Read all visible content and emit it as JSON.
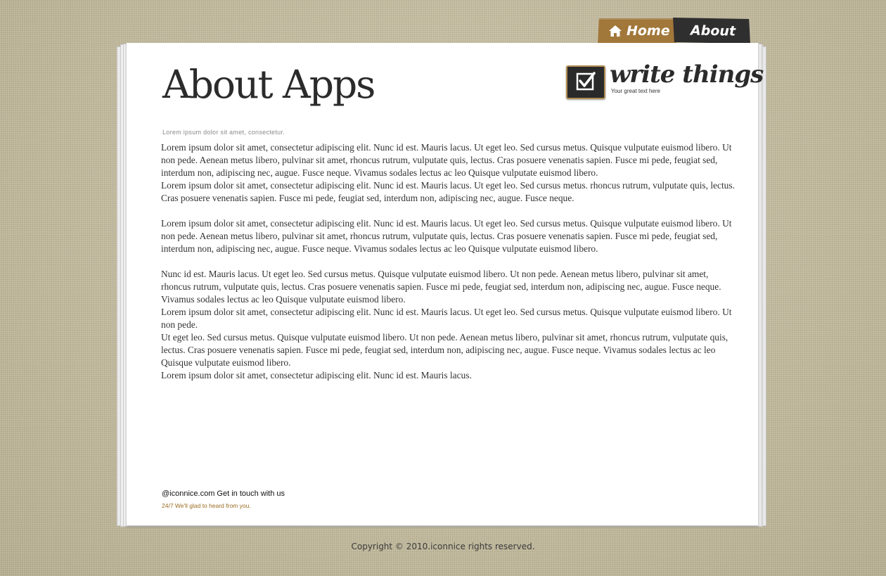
{
  "nav": {
    "home_label": "Home",
    "about_label": "About",
    "home_color": "#a2773a",
    "about_color": "#2f2f2f"
  },
  "header": {
    "title": "About Apps",
    "logo_text": "write things",
    "logo_tagline": "Your great text here",
    "logo_icon": "checkbox-icon"
  },
  "main": {
    "subheading": "Lorem ipsum dolor sit amet, consectetur.",
    "paragraph_1": "Lorem ipsum dolor sit amet, consectetur adipiscing elit. Nunc id est. Mauris lacus. Ut eget leo. Sed cursus metus. Quisque vulputate euismod libero. Ut non pede. Aenean metus libero, pulvinar sit amet, rhoncus rutrum, vulputate quis, lectus. Cras posuere venenatis sapien. Fusce mi pede, feugiat sed, interdum non, adipiscing nec, augue. Fusce neque. Vivamus sodales lectus ac leo Quisque vulputate euismod libero.",
    "paragraph_2": "Lorem ipsum dolor sit amet, consectetur adipiscing elit. Nunc id est. Mauris lacus. Ut eget leo. Sed cursus metus. rhoncus rutrum, vulputate quis, lectus. Cras posuere venenatis sapien. Fusce mi pede, feugiat sed, interdum non, adipiscing nec, augue. Fusce neque.",
    "paragraph_3": "Lorem ipsum dolor sit amet, consectetur adipiscing elit. Nunc id est. Mauris lacus. Ut eget leo. Sed cursus metus. Quisque vulputate euismod libero. Ut non pede. Aenean metus libero, pulvinar sit amet, rhoncus rutrum, vulputate quis, lectus. Cras posuere venenatis sapien. Fusce mi pede, feugiat sed, interdum non, adipiscing nec, augue. Fusce neque. Vivamus sodales lectus ac leo Quisque vulputate euismod libero.",
    "paragraph_4": "Nunc id est. Mauris lacus. Ut eget leo. Sed cursus metus. Quisque vulputate euismod libero. Ut non pede. Aenean metus libero, pulvinar sit amet, rhoncus rutrum, vulputate quis, lectus. Cras posuere venenatis sapien. Fusce mi pede, feugiat sed, interdum non, adipiscing nec, augue. Fusce neque. Vivamus sodales lectus ac leo Quisque vulputate euismod libero.",
    "paragraph_5": "Lorem ipsum dolor sit amet, consectetur adipiscing elit. Nunc id est. Mauris lacus. Ut eget leo. Sed cursus metus. Quisque vulputate euismod libero. Ut non pede.",
    "paragraph_6": "Ut eget leo. Sed cursus metus. Quisque vulputate euismod libero. Ut non pede. Aenean metus libero, pulvinar sit amet, rhoncus rutrum, vulputate quis, lectus. Cras posuere venenatis sapien. Fusce mi pede, feugiat sed, interdum non, adipiscing nec, augue. Fusce neque. Vivamus sodales lectus ac leo Quisque vulputate euismod libero.",
    "paragraph_7": "Lorem ipsum dolor sit amet, consectetur adipiscing elit. Nunc id est. Mauris lacus."
  },
  "contact": {
    "line": "@iconnice.com Get in touch with us",
    "subline": "24/7 We'll glad to heard from you.",
    "subline_color": "#9b6c22"
  },
  "footer": {
    "copyright": "Copyright © 2010.iconnice rights reserved."
  }
}
